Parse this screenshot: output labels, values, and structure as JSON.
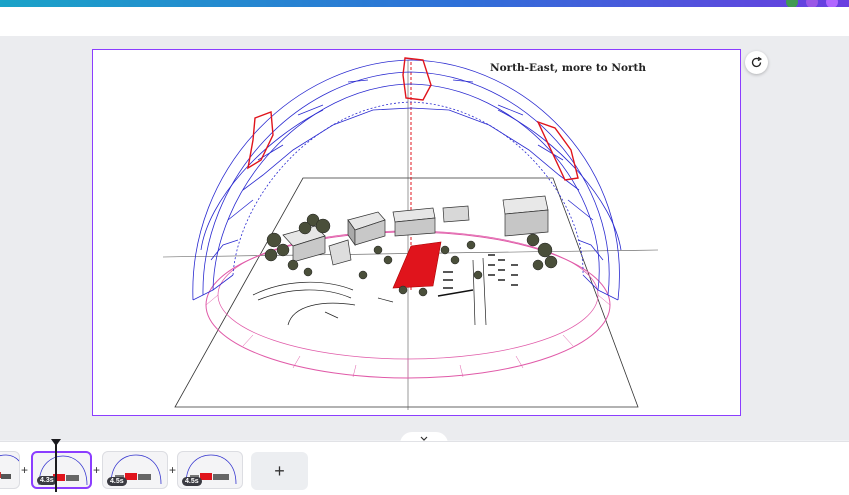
{
  "slide": {
    "caption": "North-East, more to North"
  },
  "controls": {
    "refresh_icon": "refresh-icon",
    "collapse_icon": "chevron-down-icon",
    "add_page_label": "+"
  },
  "timeline": {
    "separator": "+",
    "thumbnails": [
      {
        "duration": ""
      },
      {
        "duration": "4.3s",
        "selected": true
      },
      {
        "duration": "4.5s"
      },
      {
        "duration": "4.5s"
      }
    ]
  },
  "colors": {
    "accent": "#8b3dff",
    "dome": "#2a2ad0",
    "highlight": "#e0141c",
    "ring": "#e05aa8"
  }
}
